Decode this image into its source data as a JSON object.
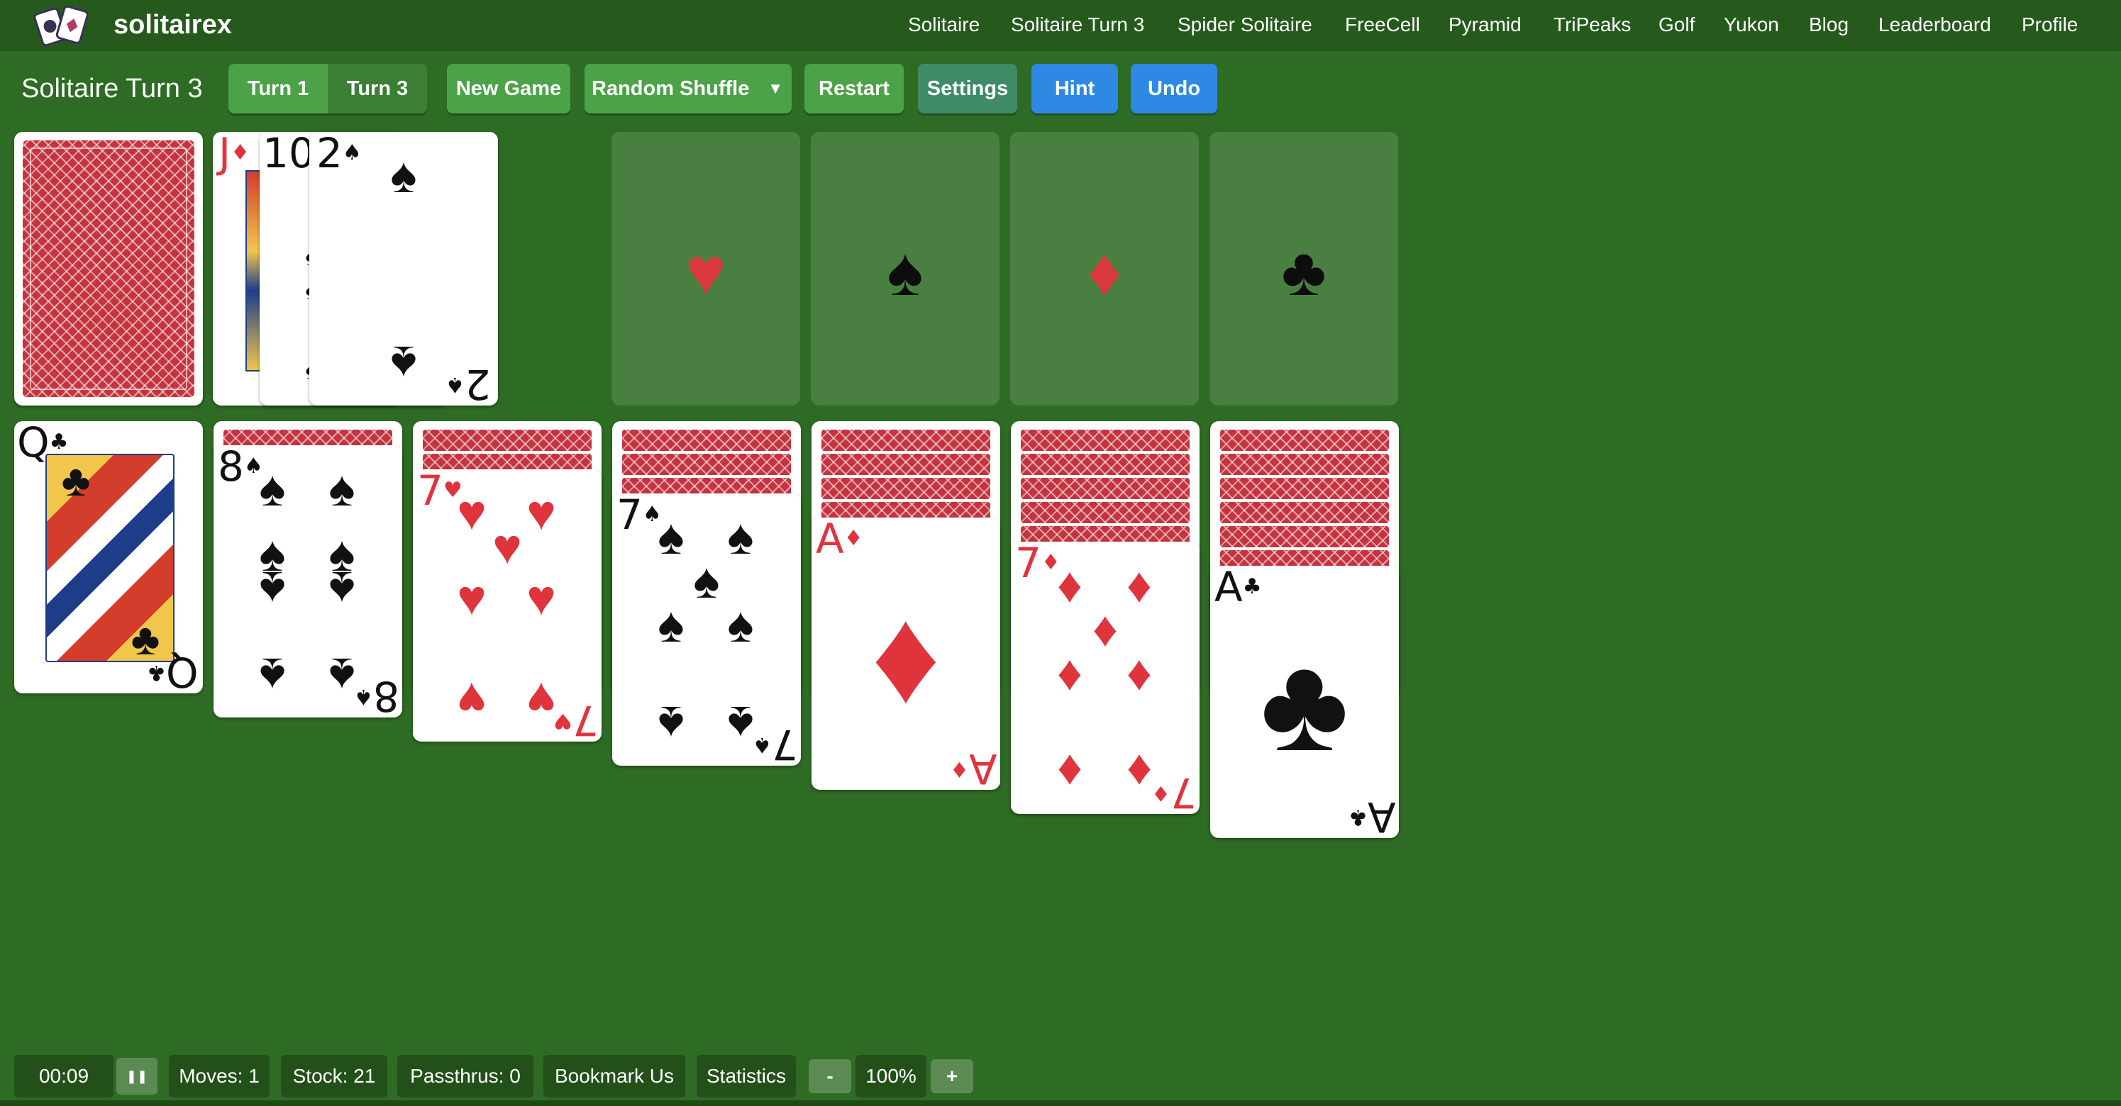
{
  "brand": {
    "name": "solitairex",
    "logo_icon": "cards-logo-icon"
  },
  "nav": {
    "items": [
      {
        "label": "Solitaire"
      },
      {
        "label": "Solitaire Turn 3"
      },
      {
        "label": "Spider Solitaire"
      },
      {
        "label": "FreeCell"
      },
      {
        "label": "Pyramid"
      },
      {
        "label": "TriPeaks"
      },
      {
        "label": "Golf"
      },
      {
        "label": "Yukon"
      },
      {
        "label": "Blog"
      },
      {
        "label": "Leaderboard"
      },
      {
        "label": "Profile"
      }
    ]
  },
  "toolbar": {
    "title": "Solitaire Turn 3",
    "turn_options": [
      "Turn 1",
      "Turn 3"
    ],
    "selected_turn": "Turn 3",
    "new_game": "New Game",
    "random_shuffle": "Random Shuffle",
    "dropdown_arrow": "▼",
    "restart": "Restart",
    "settings": "Settings",
    "hint": "Hint",
    "undo": "Undo"
  },
  "colors": {
    "felt": "#2e6b24",
    "topbar": "#265a1d",
    "button_green": "#4ca248",
    "button_blue": "#2f88e3",
    "card_back": "#c4343f",
    "red_suit": "#e0343c"
  },
  "stock": {
    "face_down": true
  },
  "waste": {
    "cards": [
      {
        "rank": "J",
        "suit": "♦",
        "color": "red"
      },
      {
        "rank": "10",
        "suit": "♠",
        "color": "black"
      },
      {
        "rank": "2",
        "suit": "♠",
        "color": "black"
      }
    ]
  },
  "foundations": [
    {
      "suit": "♥",
      "color": "red",
      "icon": "heart-icon"
    },
    {
      "suit": "♠",
      "color": "black",
      "icon": "spade-icon"
    },
    {
      "suit": "♦",
      "color": "red",
      "icon": "diamond-icon"
    },
    {
      "suit": "♣",
      "color": "black",
      "icon": "club-icon"
    }
  ],
  "tableau": [
    {
      "hidden": 0,
      "rank": "Q",
      "suit": "♣",
      "color": "black"
    },
    {
      "hidden": 1,
      "rank": "8",
      "suit": "♠",
      "color": "black"
    },
    {
      "hidden": 2,
      "rank": "7",
      "suit": "♥",
      "color": "red"
    },
    {
      "hidden": 3,
      "rank": "7",
      "suit": "♠",
      "color": "black"
    },
    {
      "hidden": 4,
      "rank": "A",
      "suit": "♦",
      "color": "red"
    },
    {
      "hidden": 5,
      "rank": "7",
      "suit": "♦",
      "color": "red"
    },
    {
      "hidden": 6,
      "rank": "A",
      "suit": "♣",
      "color": "black"
    }
  ],
  "status": {
    "time": "00:09",
    "pause_icon": "pause-icon",
    "pause_glyph": "❚❚",
    "moves": "Moves: 1",
    "stock": "Stock: 21",
    "passthrus": "Passthrus: 0",
    "bookmark": "Bookmark Us",
    "statistics": "Statistics",
    "zoom_out": "-",
    "zoom": "100%",
    "zoom_in": "+"
  }
}
